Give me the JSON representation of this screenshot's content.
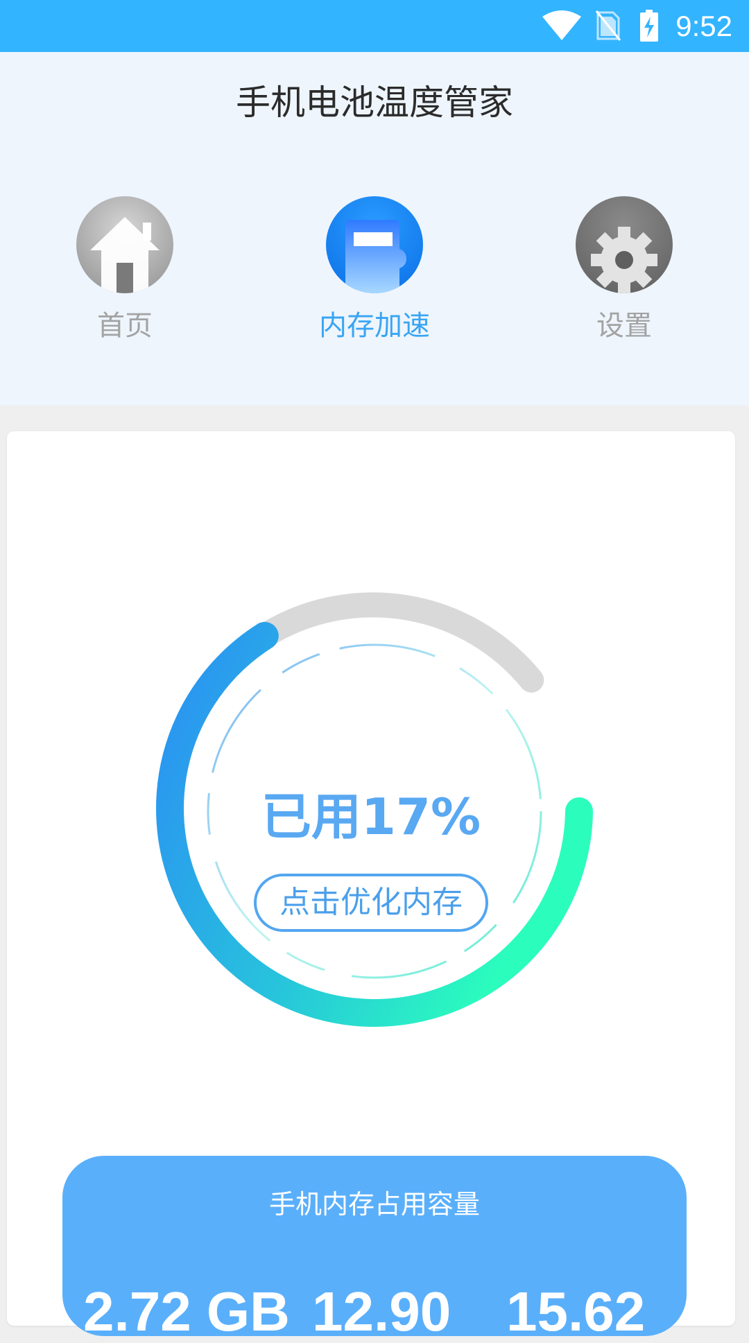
{
  "status_bar": {
    "time": "9:52",
    "icons": [
      "wifi-icon",
      "no-sim-icon",
      "battery-charging-icon"
    ],
    "color": "#33b4ff"
  },
  "app": {
    "title": "手机电池温度管家"
  },
  "nav": {
    "items": [
      {
        "label": "首页",
        "icon": "home-icon",
        "active": false
      },
      {
        "label": "内存加速",
        "icon": "memory-card-icon",
        "active": true
      },
      {
        "label": "设置",
        "icon": "gear-icon",
        "active": false
      }
    ],
    "active_color": "#38a5f3",
    "inactive_color": "#a3a3a3"
  },
  "gauge": {
    "used_percent": 17,
    "used_text": "已用17%",
    "button_label": "点击优化内存",
    "gradient_colors": [
      "#2b8ff3",
      "#2bfdbd"
    ],
    "track_color": "#d9d9d9"
  },
  "memory_panel": {
    "title": "手机内存占用容量",
    "values": [
      "2.72 GB",
      "12.90",
      "15.62"
    ],
    "color": "#5aaffb"
  }
}
